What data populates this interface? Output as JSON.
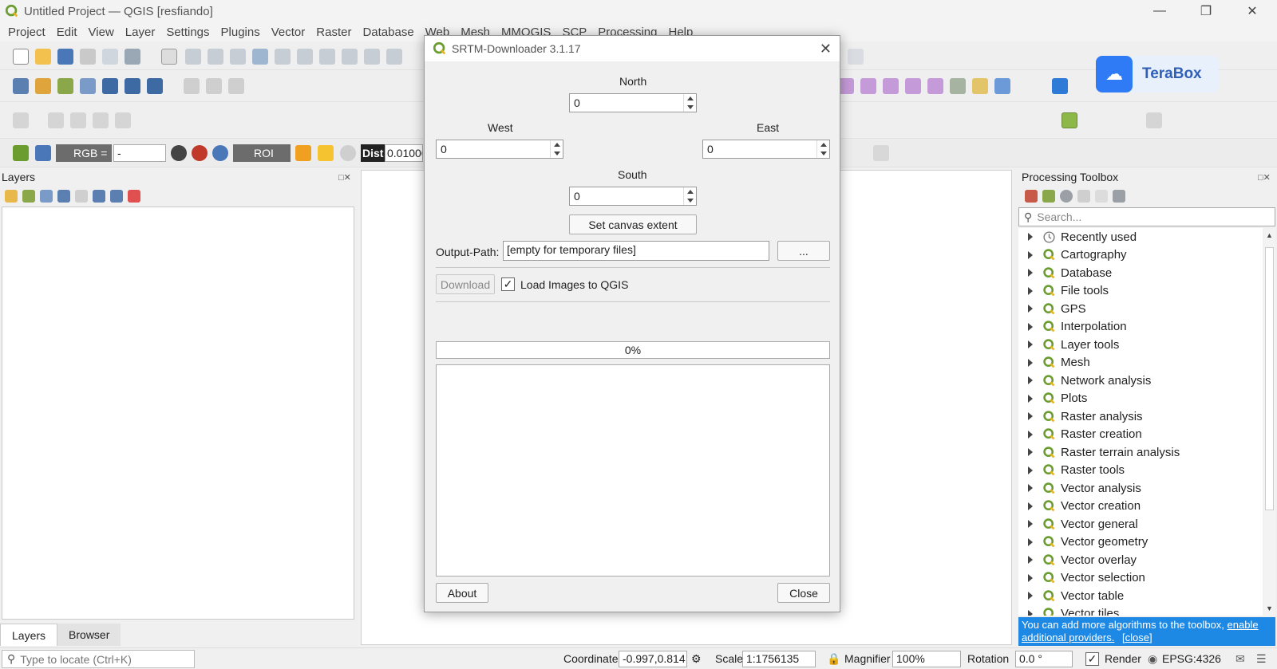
{
  "window": {
    "title": "Untitled Project — QGIS [resfiando]"
  },
  "menu": [
    "Project",
    "Edit",
    "View",
    "Layer",
    "Settings",
    "Plugins",
    "Vector",
    "Raster",
    "Database",
    "Web",
    "Mesh",
    "MMQGIS",
    "SCP",
    "Processing",
    "Help"
  ],
  "toolbar4": {
    "rgb_label": "RGB =",
    "rgb_value": "-",
    "roi_label": "ROI",
    "dist_label": "Dist",
    "dist_value": "0.01000"
  },
  "terabox": {
    "label": "TeraBox"
  },
  "layers_panel": {
    "title": "Layers",
    "tabs": [
      "Layers",
      "Browser"
    ],
    "locate_placeholder": "Type to locate (Ctrl+K)"
  },
  "dialog": {
    "title": "SRTM-Downloader 3.1.17",
    "north_label": "North",
    "north_value": "0",
    "west_label": "West",
    "west_value": "0",
    "east_label": "East",
    "east_value": "0",
    "south_label": "South",
    "south_value": "0",
    "set_extent_label": "Set canvas extent",
    "output_label": "Output-Path:",
    "output_value": "[empty for temporary files]",
    "browse_label": "...",
    "download_label": "Download",
    "load_images_label": "Load Images to QGIS",
    "load_images_checked": true,
    "progress_text": "0%",
    "progress": 0,
    "about_label": "About",
    "close_label": "Close"
  },
  "processing_toolbox": {
    "title": "Processing Toolbox",
    "search_placeholder": "Search...",
    "items": [
      {
        "label": "Recently used",
        "icon": "clock-icon"
      },
      {
        "label": "Cartography",
        "icon": "qgis-icon"
      },
      {
        "label": "Database",
        "icon": "qgis-icon"
      },
      {
        "label": "File tools",
        "icon": "qgis-icon"
      },
      {
        "label": "GPS",
        "icon": "qgis-icon"
      },
      {
        "label": "Interpolation",
        "icon": "qgis-icon"
      },
      {
        "label": "Layer tools",
        "icon": "qgis-icon"
      },
      {
        "label": "Mesh",
        "icon": "qgis-icon"
      },
      {
        "label": "Network analysis",
        "icon": "qgis-icon"
      },
      {
        "label": "Plots",
        "icon": "qgis-icon"
      },
      {
        "label": "Raster analysis",
        "icon": "qgis-icon"
      },
      {
        "label": "Raster creation",
        "icon": "qgis-icon"
      },
      {
        "label": "Raster terrain analysis",
        "icon": "qgis-icon"
      },
      {
        "label": "Raster tools",
        "icon": "qgis-icon"
      },
      {
        "label": "Vector analysis",
        "icon": "qgis-icon"
      },
      {
        "label": "Vector creation",
        "icon": "qgis-icon"
      },
      {
        "label": "Vector general",
        "icon": "qgis-icon"
      },
      {
        "label": "Vector geometry",
        "icon": "qgis-icon"
      },
      {
        "label": "Vector overlay",
        "icon": "qgis-icon"
      },
      {
        "label": "Vector selection",
        "icon": "qgis-icon"
      },
      {
        "label": "Vector table",
        "icon": "qgis-icon"
      },
      {
        "label": "Vector tiles",
        "icon": "qgis-icon"
      }
    ],
    "note_text": "You can add more algorithms to the toolbox,",
    "note_link1": "enable additional providers.",
    "note_link2": "[close]"
  },
  "statusbar": {
    "coordinate_label": "Coordinate",
    "coordinate_value": "-0.997,0.814",
    "scale_label": "Scale",
    "scale_value": "1:1756135",
    "magnifier_label": "Magnifier",
    "magnifier_value": "100%",
    "rotation_label": "Rotation",
    "rotation_value": "0.0 °",
    "render_label": "Render",
    "render_checked": true,
    "crs_label": "EPSG:4326"
  },
  "colors": {
    "qgis_green": "#6a9c2f",
    "note_blue": "#1e88e5",
    "terabox_blue": "#2f7bf5"
  }
}
